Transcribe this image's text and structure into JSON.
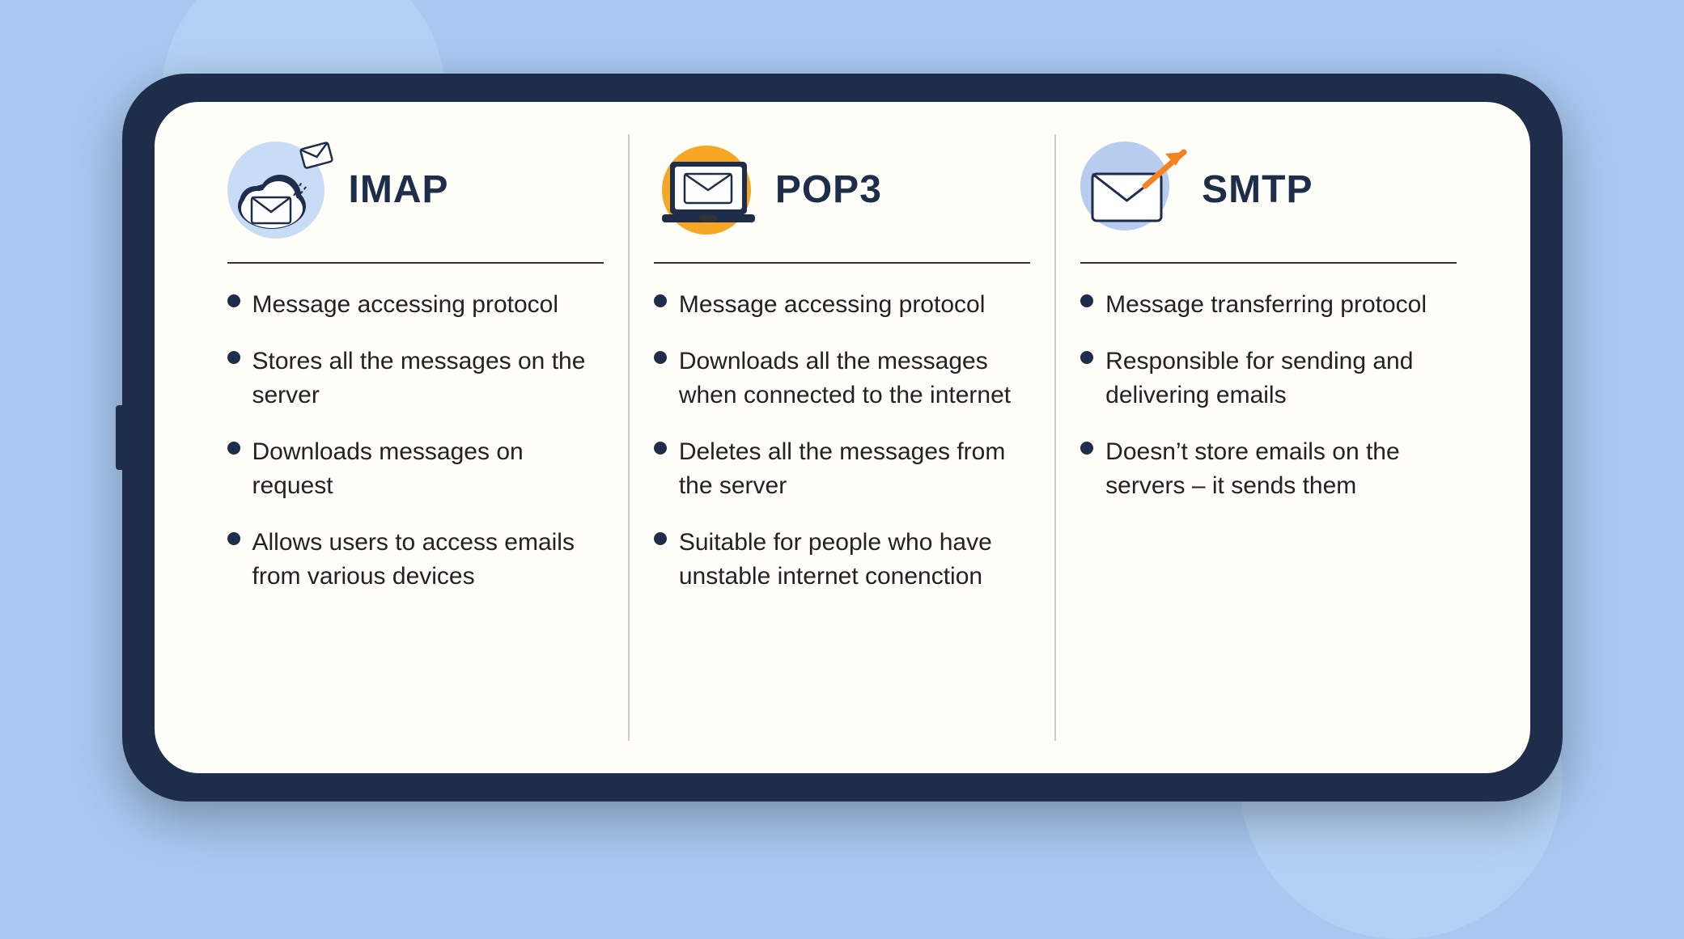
{
  "background_color": "#a8c8f0",
  "columns": [
    {
      "id": "imap",
      "title": "IMAP",
      "icon_type": "cloud-email",
      "icon_bg_color": "#c5d9f5",
      "bullet_points": [
        "Message accessing protocol",
        "Stores all the messages on the server",
        "Downloads messages on request",
        "Allows users to access emails from various devices"
      ]
    },
    {
      "id": "pop3",
      "title": "POP3",
      "icon_type": "laptop-email",
      "icon_bg_color": "#f5a623",
      "bullet_points": [
        "Message accessing protocol",
        "Downloads all the messages when connected to the internet",
        "Deletes all the messages from the server",
        "Suitable for people who have unstable internet conenction"
      ]
    },
    {
      "id": "smtp",
      "title": "SMTP",
      "icon_type": "email-arrow",
      "icon_bg_color": "#b8ccf0",
      "bullet_points": [
        "Message transferring protocol",
        "Responsible for sending and delivering emails",
        "Doesn’t store emails on the servers – it sends them"
      ]
    }
  ]
}
